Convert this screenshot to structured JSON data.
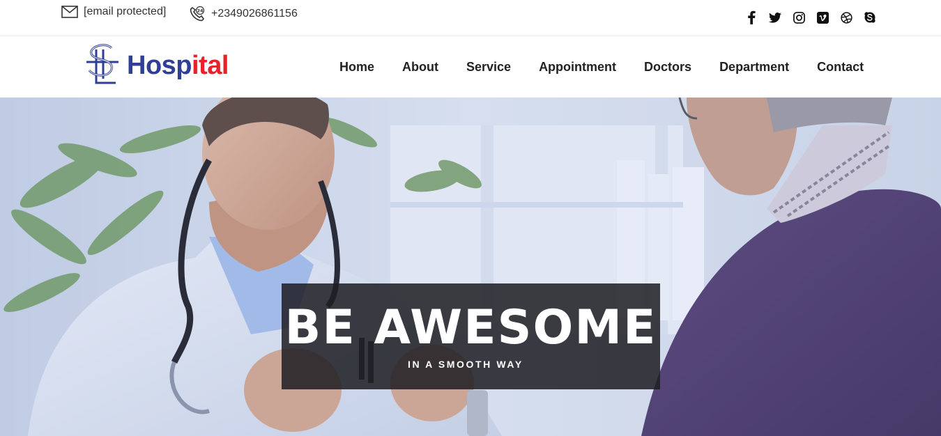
{
  "topbar": {
    "email": "[email protected]",
    "phone": "+2349026861156",
    "phone_badge": "24",
    "socials": [
      {
        "icon": "facebook-icon"
      },
      {
        "icon": "twitter-icon"
      },
      {
        "icon": "instagram-icon"
      },
      {
        "icon": "vimeo-icon"
      },
      {
        "icon": "dribbble-icon"
      },
      {
        "icon": "skype-icon"
      }
    ]
  },
  "logo": {
    "text_main": "Hosp",
    "text_accent": "ital",
    "color_main": "#2f3f95",
    "color_accent": "#e8212a"
  },
  "nav": {
    "items": [
      "Home",
      "About",
      "Service",
      "Appointment",
      "Doctors",
      "Department",
      "Contact"
    ]
  },
  "hero": {
    "title": "BE AWESOME",
    "subtitle": "IN A SMOOTH WAY"
  }
}
